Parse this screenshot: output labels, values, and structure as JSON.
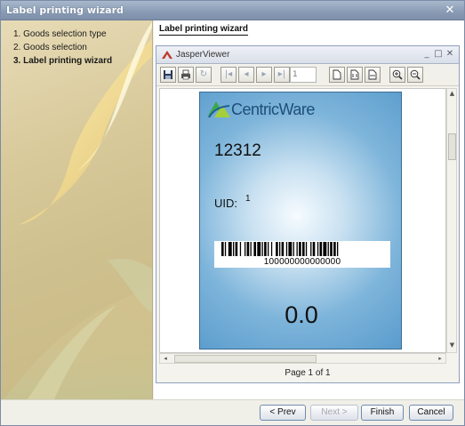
{
  "window": {
    "title": "Label printing wizard"
  },
  "steps": [
    {
      "label": "1. Goods selection type",
      "active": false
    },
    {
      "label": "2. Goods selection",
      "active": false
    },
    {
      "label": "3. Label printing wizard",
      "active": true
    }
  ],
  "panel": {
    "heading": "Label printing wizard"
  },
  "viewer": {
    "title": "JasperViewer",
    "page_input": "1",
    "page_status": "Page 1 of 1",
    "controls": {
      "minimize": "_",
      "maximize": "□",
      "close": "✕"
    },
    "icons": [
      "save-icon",
      "print-icon",
      "reload-icon",
      "first-page-icon",
      "prev-page-icon",
      "next-page-icon",
      "last-page-icon",
      "actual-size-icon",
      "fit-page-icon",
      "fit-width-icon",
      "zoom-in-icon",
      "zoom-out-icon"
    ]
  },
  "label": {
    "brand": "CentricWare",
    "code": "12312",
    "uid_label": "UID:",
    "uid_value": "1",
    "barcode_text": "100000000000000",
    "amount": "0.0"
  },
  "buttons": {
    "prev": "< Prev",
    "next": "Next >",
    "finish": "Finish",
    "cancel": "Cancel"
  }
}
